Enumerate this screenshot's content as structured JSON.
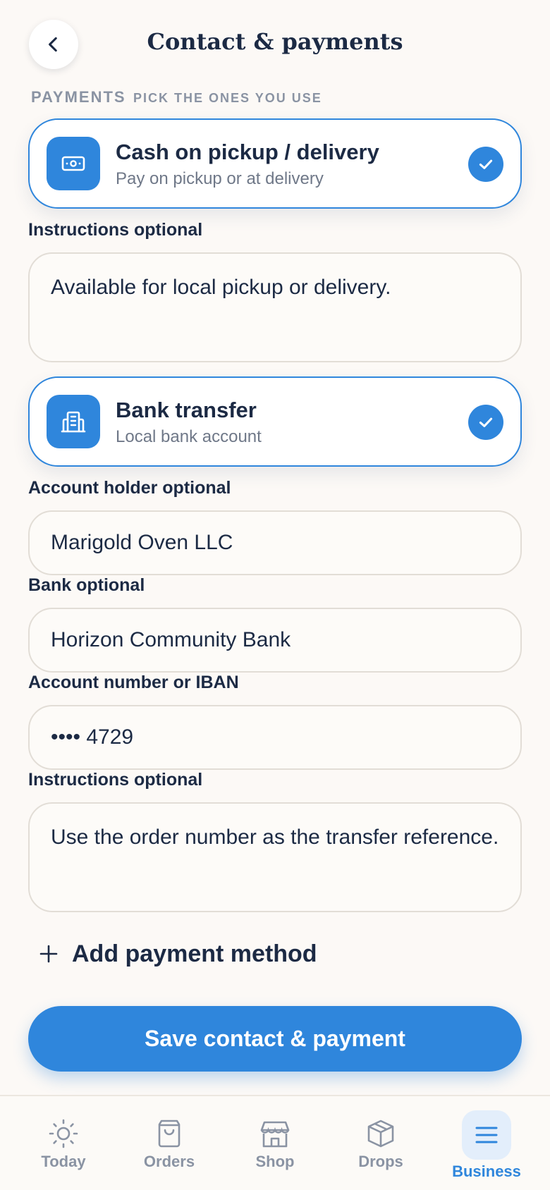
{
  "header": {
    "title": "Contact & payments"
  },
  "section": {
    "label": "PAYMENTS",
    "hint": "PICK THE ONES YOU USE"
  },
  "methods": [
    {
      "title": "Cash on pickup / delivery",
      "subtitle": "Pay on pickup or at delivery",
      "icon": "cash-icon",
      "selected": true,
      "instructions_label": "Instructions optional",
      "instructions_value": "Available for local pickup or delivery."
    },
    {
      "title": "Bank transfer",
      "subtitle": "Local bank account",
      "icon": "bank-icon",
      "selected": true,
      "holder_label": "Account holder optional",
      "holder_value": "Marigold Oven LLC",
      "bank_label": "Bank optional",
      "bank_value": "Horizon Community Bank",
      "account_label": "Account number or IBAN",
      "account_value": "•••• 4729",
      "instructions_label": "Instructions optional",
      "instructions_value": "Use the order number as the transfer reference."
    }
  ],
  "add_method": {
    "label": "Add payment method"
  },
  "save_button": {
    "label": "Save contact & payment"
  },
  "nav": {
    "items": [
      {
        "label": "Today",
        "icon": "sun-icon"
      },
      {
        "label": "Orders",
        "icon": "bag-icon"
      },
      {
        "label": "Shop",
        "icon": "store-icon"
      },
      {
        "label": "Drops",
        "icon": "box-icon"
      },
      {
        "label": "Business",
        "icon": "menu-icon",
        "active": true
      }
    ]
  },
  "colors": {
    "accent": "#2f86dc",
    "text": "#1c2a44",
    "muted": "#8a93a3",
    "background": "#fcf9f6"
  }
}
